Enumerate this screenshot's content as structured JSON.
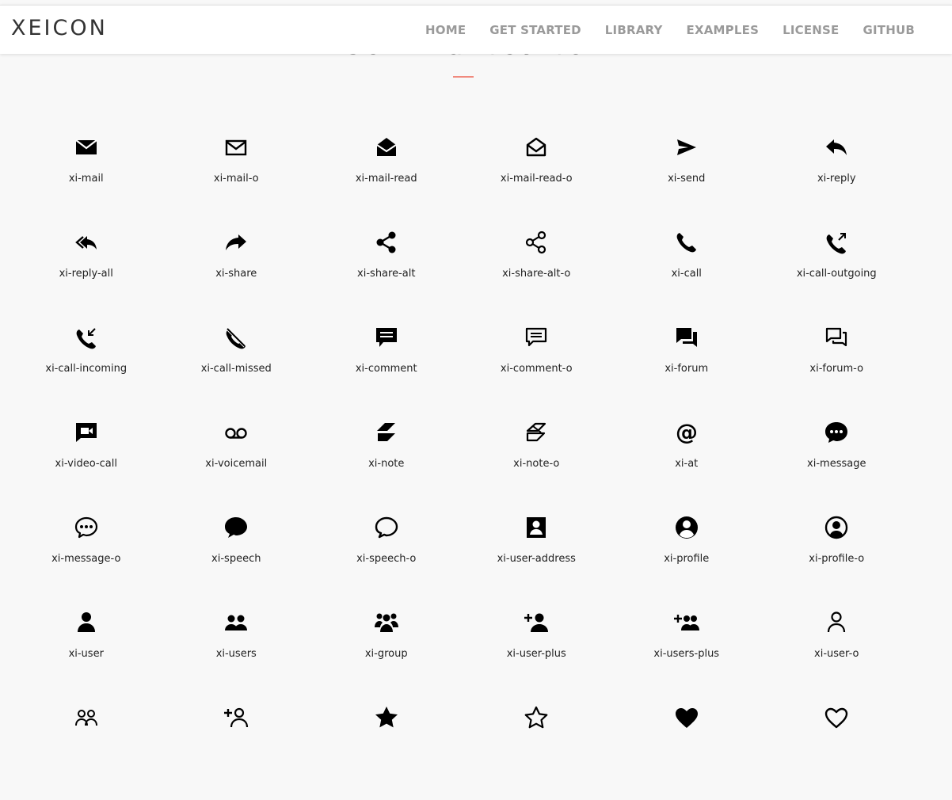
{
  "navbar": {
    "brand": "XEICON",
    "links": [
      "HOME",
      "GET STARTED",
      "LIBRARY",
      "EXAMPLES",
      "LICENSE",
      "GITHUB"
    ]
  },
  "section": {
    "title": "Communication",
    "accent_color": "#f08a7e"
  },
  "icons": [
    {
      "label": "xi-mail",
      "icon": "mail-icon"
    },
    {
      "label": "xi-mail-o",
      "icon": "mail-outline-icon"
    },
    {
      "label": "xi-mail-read",
      "icon": "mail-read-icon"
    },
    {
      "label": "xi-mail-read-o",
      "icon": "mail-read-outline-icon"
    },
    {
      "label": "xi-send",
      "icon": "send-icon"
    },
    {
      "label": "xi-reply",
      "icon": "reply-icon"
    },
    {
      "label": "xi-reply-all",
      "icon": "reply-all-icon"
    },
    {
      "label": "xi-share",
      "icon": "share-icon"
    },
    {
      "label": "xi-share-alt",
      "icon": "share-alt-icon"
    },
    {
      "label": "xi-share-alt-o",
      "icon": "share-alt-outline-icon"
    },
    {
      "label": "xi-call",
      "icon": "call-icon"
    },
    {
      "label": "xi-call-outgoing",
      "icon": "call-outgoing-icon"
    },
    {
      "label": "xi-call-incoming",
      "icon": "call-incoming-icon"
    },
    {
      "label": "xi-call-missed",
      "icon": "call-missed-icon"
    },
    {
      "label": "xi-comment",
      "icon": "comment-icon"
    },
    {
      "label": "xi-comment-o",
      "icon": "comment-outline-icon"
    },
    {
      "label": "xi-forum",
      "icon": "forum-icon"
    },
    {
      "label": "xi-forum-o",
      "icon": "forum-outline-icon"
    },
    {
      "label": "xi-video-call",
      "icon": "video-call-icon"
    },
    {
      "label": "xi-voicemail",
      "icon": "voicemail-icon"
    },
    {
      "label": "xi-note",
      "icon": "note-icon"
    },
    {
      "label": "xi-note-o",
      "icon": "note-outline-icon"
    },
    {
      "label": "xi-at",
      "icon": "at-icon"
    },
    {
      "label": "xi-message",
      "icon": "message-icon"
    },
    {
      "label": "xi-message-o",
      "icon": "message-outline-icon"
    },
    {
      "label": "xi-speech",
      "icon": "speech-icon"
    },
    {
      "label": "xi-speech-o",
      "icon": "speech-outline-icon"
    },
    {
      "label": "xi-user-address",
      "icon": "user-address-icon"
    },
    {
      "label": "xi-profile",
      "icon": "profile-icon"
    },
    {
      "label": "xi-profile-o",
      "icon": "profile-outline-icon"
    },
    {
      "label": "xi-user",
      "icon": "user-icon"
    },
    {
      "label": "xi-users",
      "icon": "users-icon"
    },
    {
      "label": "xi-group",
      "icon": "group-icon"
    },
    {
      "label": "xi-user-plus",
      "icon": "user-plus-icon"
    },
    {
      "label": "xi-users-plus",
      "icon": "users-plus-icon"
    },
    {
      "label": "xi-user-o",
      "icon": "user-outline-icon"
    },
    {
      "label": "",
      "icon": "users-outline-icon"
    },
    {
      "label": "",
      "icon": "user-plus-outline-icon"
    },
    {
      "label": "",
      "icon": "star-icon"
    },
    {
      "label": "",
      "icon": "star-outline-icon"
    },
    {
      "label": "",
      "icon": "heart-icon"
    },
    {
      "label": "",
      "icon": "heart-outline-icon"
    }
  ]
}
